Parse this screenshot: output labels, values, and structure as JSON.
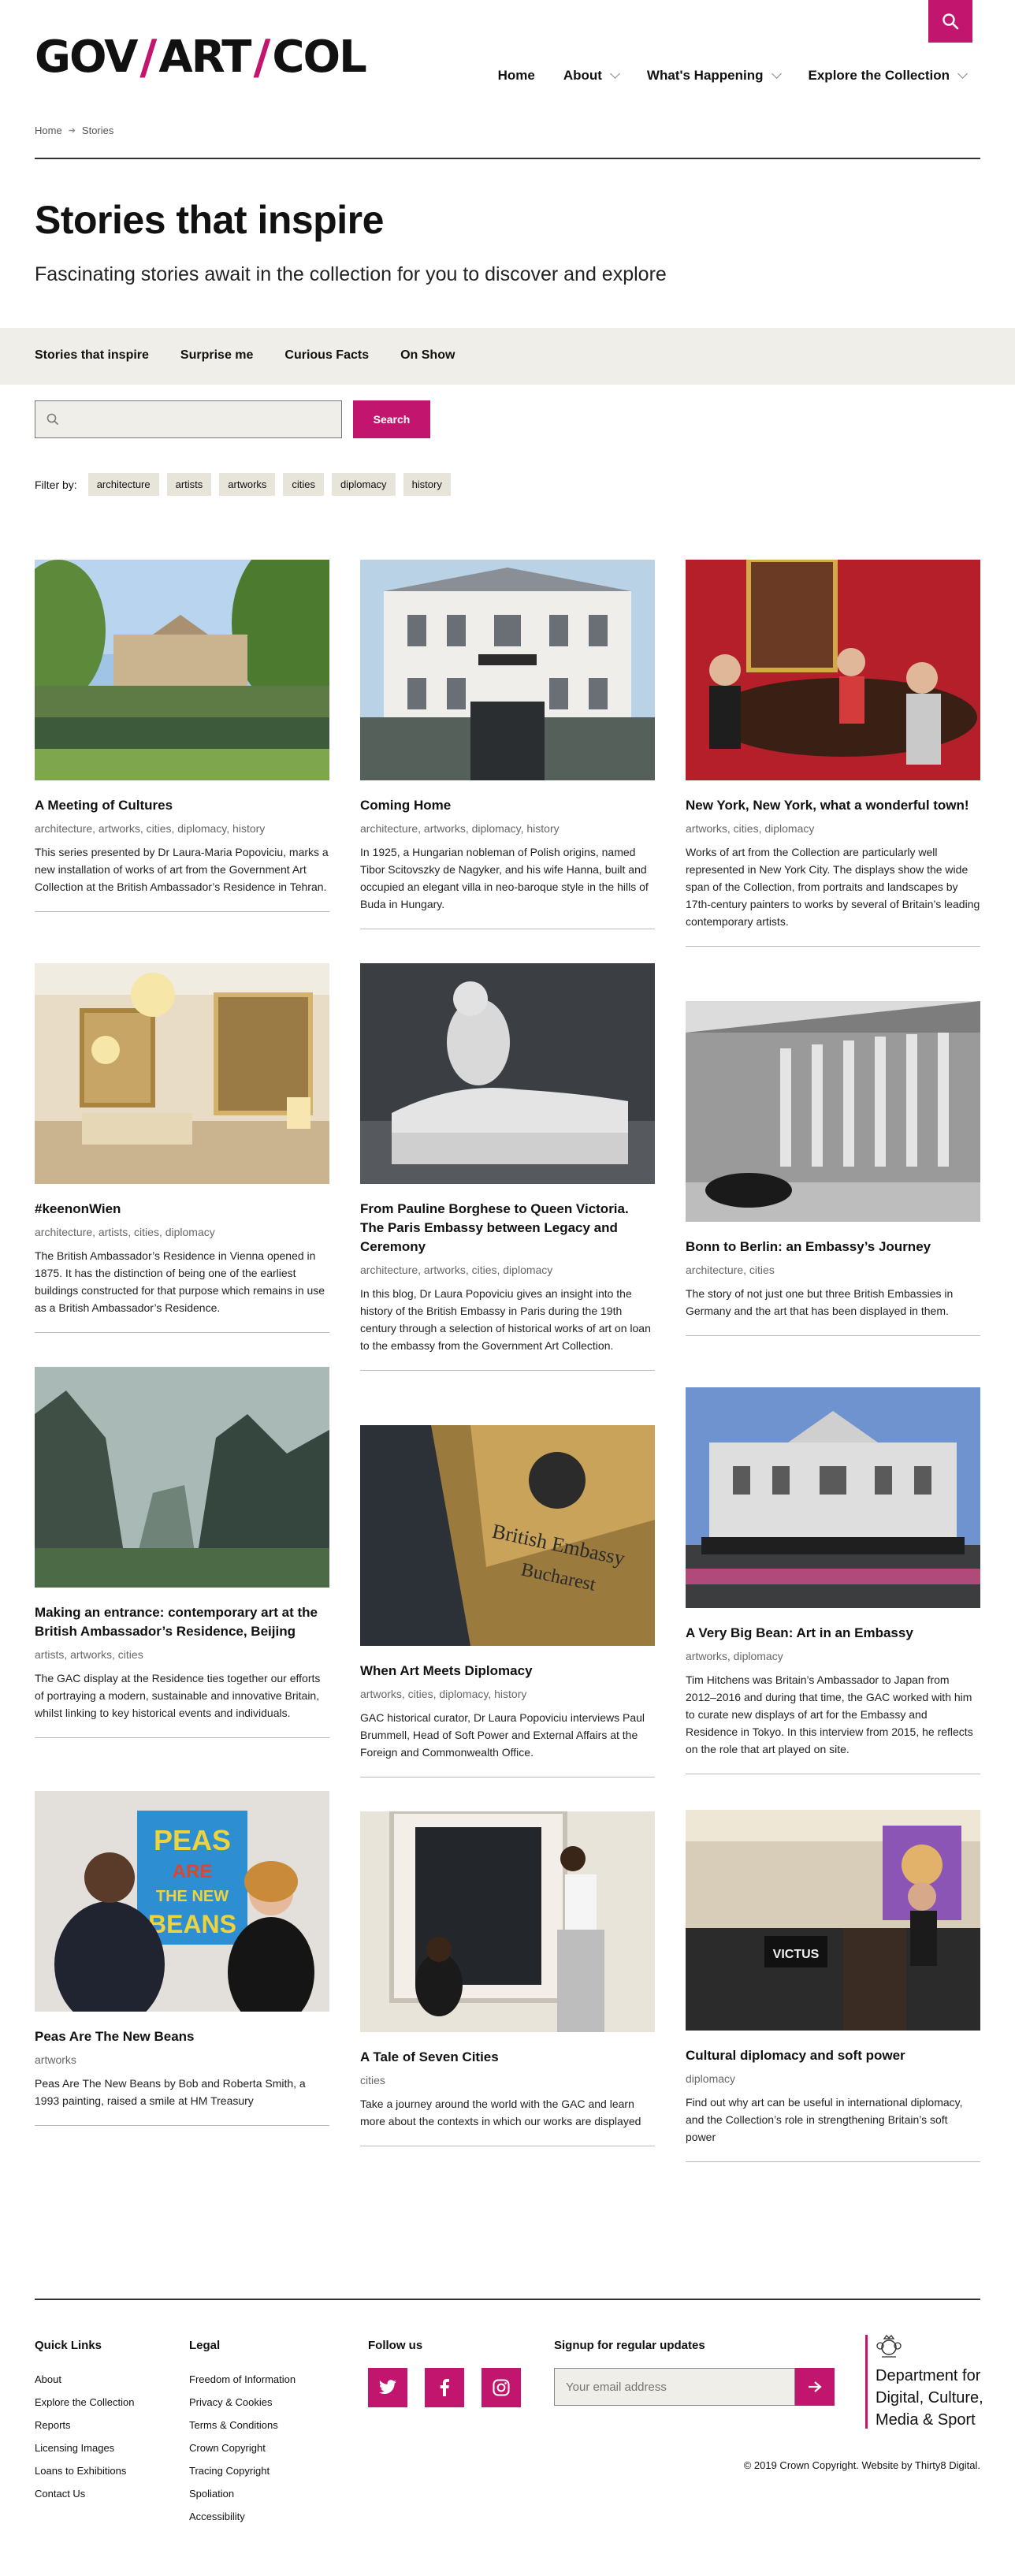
{
  "header": {
    "logo_parts": [
      "GOV",
      "ART",
      "COL"
    ],
    "nav": [
      {
        "label": "Home",
        "has_dropdown": false
      },
      {
        "label": "About",
        "has_dropdown": true
      },
      {
        "label": "What's Happening",
        "has_dropdown": true
      },
      {
        "label": "Explore the Collection",
        "has_dropdown": true
      }
    ],
    "search_icon": "search-icon"
  },
  "breadcrumb": {
    "home": "Home",
    "current": "Stories"
  },
  "page": {
    "title": "Stories that inspire",
    "subtitle": "Fascinating stories await in the collection for you to discover and explore"
  },
  "tabs": [
    "Stories that inspire",
    "Surprise me",
    "Curious Facts",
    "On Show"
  ],
  "search": {
    "placeholder": "",
    "button": "Search"
  },
  "filter": {
    "label": "Filter by:",
    "tags": [
      "architecture",
      "artists",
      "artworks",
      "cities",
      "diplomacy",
      "history"
    ]
  },
  "cards": [
    {
      "title": "A Meeting of Cultures",
      "tags": "architecture, artworks, cities, diplomacy, history",
      "text": "This series presented by Dr Laura-Maria Popoviciu, marks a new installation of works of art from the Government Art Collection at the British Ambassador’s Residence in Tehran."
    },
    {
      "title": "Coming Home",
      "tags": "architecture, artworks, diplomacy, history",
      "text": "In 1925, a Hungarian nobleman of Polish origins, named Tibor Scitovszky de Nagyker, and his wife Hanna, built and occupied an elegant villa in neo-baroque style in the hills of Buda in Hungary."
    },
    {
      "title": "New York, New York, what a wonderful town!",
      "tags": "artworks, cities, diplomacy",
      "text": "Works of art from the Collection are particularly well represented in New York City. The displays show the wide span of the Collection, from portraits and landscapes by 17th-century painters to works by several of Britain’s leading contemporary artists."
    },
    {
      "title": "#keenonWien",
      "tags": "architecture, artists, cities, diplomacy",
      "text": "The British Ambassador’s Residence in Vienna opened in 1875. It has the distinction of being one of the earliest buildings constructed for that purpose which remains in use as a British Ambassador’s Residence."
    },
    {
      "title": "From Pauline Borghese to Queen Victoria. The Paris Embassy between Legacy and Ceremony",
      "tags": "architecture, artworks, cities, diplomacy",
      "text": "In this blog, Dr Laura Popoviciu gives an insight into the history of the British Embassy in Paris during the 19th century through a selection of historical works of art on loan to the embassy from the Government Art Collection."
    },
    {
      "title": "Bonn to Berlin: an Embassy’s Journey",
      "tags": "architecture, cities",
      "text": "The story of not just one but three British Embassies in Germany and the art that has been displayed in them."
    },
    {
      "title": "Making an entrance: contemporary art at the British Ambassador’s Residence, Beijing",
      "tags": "artists, artworks, cities",
      "text": "The GAC display at the Residence ties together our efforts of portraying a modern, sustainable and innovative Britain, whilst linking to key historical events and individuals."
    },
    {
      "title": "When Art Meets Diplomacy",
      "tags": "artworks, cities, diplomacy, history",
      "text": "GAC historical curator, Dr Laura Popoviciu interviews Paul Brummell, Head of Soft Power and External Affairs at the Foreign and Commonwealth Office.",
      "image_text": [
        "British Embassy",
        "Bucharest"
      ]
    },
    {
      "title": "A Very Big Bean: Art in an Embassy",
      "tags": "artworks, diplomacy",
      "text": "Tim Hitchens was Britain’s Ambassador to Japan from 2012–2016 and during that time, the GAC worked with him to curate new displays of art for the Embassy and Residence in Tokyo. In this interview from 2015, he reflects on the role that art played on site."
    },
    {
      "title": "Peas Are The New Beans",
      "tags": "artworks",
      "text": "Peas Are The New Beans by Bob and Roberta Smith, a 1993 painting, raised a smile at HM Treasury",
      "image_text": [
        "PEAS",
        "ARE",
        "THE NEW",
        "BEANS"
      ]
    },
    {
      "title": "A Tale of Seven Cities",
      "tags": "cities",
      "text": "Take a journey around the world with the GAC and learn more about the contexts in which our works are displayed"
    },
    {
      "title": "Cultural diplomacy and soft power",
      "tags": "diplomacy",
      "text": "Find out why art can be useful in international diplomacy, and the Collection’s role in strengthening Britain’s soft power",
      "image_text": [
        "VICTUS"
      ]
    }
  ],
  "footer": {
    "quick_links": {
      "heading": "Quick Links",
      "items": [
        "About",
        "Explore the Collection",
        "Reports",
        "Licensing Images",
        "Loans to Exhibitions",
        "Contact Us"
      ]
    },
    "legal": {
      "heading": "Legal",
      "items": [
        "Freedom of Information",
        "Privacy & Cookies",
        "Terms & Conditions",
        "Crown Copyright",
        "Tracing Copyright",
        "Spoliation",
        "Accessibility"
      ]
    },
    "follow": {
      "heading": "Follow us",
      "icons": [
        "twitter-icon",
        "facebook-icon",
        "instagram-icon"
      ]
    },
    "signup": {
      "heading": "Signup for regular updates",
      "placeholder": "Your email address"
    },
    "dcms": [
      "Department for",
      "Digital, Culture,",
      "Media & Sport"
    ],
    "copyright": "© 2019 Crown Copyright. Website by Thirty8 Digital."
  },
  "colors": {
    "accent": "#c2166e",
    "panel": "#f0eee8",
    "tag": "#e7e4da"
  }
}
